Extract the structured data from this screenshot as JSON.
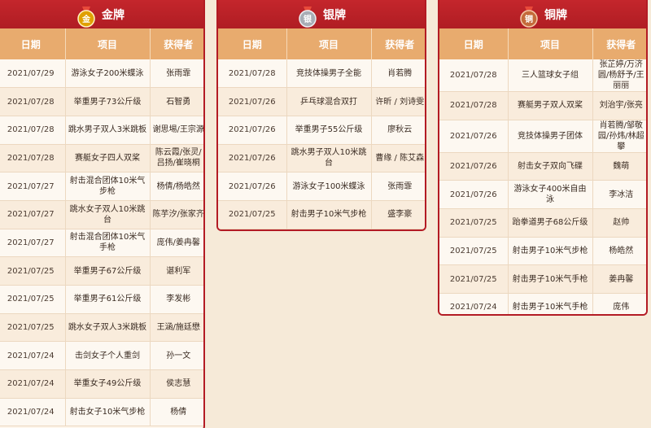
{
  "headers": {
    "date": "日期",
    "event": "项目",
    "winner": "获得者"
  },
  "gold": {
    "title": "金牌",
    "medal_char": "金",
    "medal_color": "#e0a000",
    "rows": [
      {
        "date": "2021/07/29",
        "event": "游泳女子200米蝶泳",
        "winner": "张雨霏"
      },
      {
        "date": "2021/07/28",
        "event": "举重男子73公斤级",
        "winner": "石智勇"
      },
      {
        "date": "2021/07/28",
        "event": "跳水男子双人3米跳板",
        "winner": "谢思埸/王宗源"
      },
      {
        "date": "2021/07/28",
        "event": "赛艇女子四人双桨",
        "winner": "陈云霞/张灵/吕扬/崔晓桐"
      },
      {
        "date": "2021/07/27",
        "event": "射击混合团体10米气步枪",
        "winner": "杨倩/杨皓然"
      },
      {
        "date": "2021/07/27",
        "event": "跳水女子双人10米跳台",
        "winner": "陈芋汐/张家齐"
      },
      {
        "date": "2021/07/27",
        "event": "射击混合团体10米气手枪",
        "winner": "庞伟/姜冉馨"
      },
      {
        "date": "2021/07/25",
        "event": "举重男子67公斤级",
        "winner": "谌利军"
      },
      {
        "date": "2021/07/25",
        "event": "举重男子61公斤级",
        "winner": "李发彬"
      },
      {
        "date": "2021/07/25",
        "event": "跳水女子双人3米跳板",
        "winner": "王涵/施廷懋"
      },
      {
        "date": "2021/07/24",
        "event": "击剑女子个人重剑",
        "winner": "孙一文"
      },
      {
        "date": "2021/07/24",
        "event": "举重女子49公斤级",
        "winner": "侯志慧"
      },
      {
        "date": "2021/07/24",
        "event": "射击女子10米气步枪",
        "winner": "杨倩"
      }
    ]
  },
  "silver": {
    "title": "银牌",
    "medal_char": "银",
    "medal_color": "#a8adb5",
    "rows": [
      {
        "date": "2021/07/28",
        "event": "竞技体操男子全能",
        "winner": "肖若腾"
      },
      {
        "date": "2021/07/26",
        "event": "乒乓球混合双打",
        "winner": "许昕 / 刘诗雯"
      },
      {
        "date": "2021/07/26",
        "event": "举重男子55公斤级",
        "winner": "廖秋云"
      },
      {
        "date": "2021/07/26",
        "event": "跳水男子双人10米跳台",
        "winner": "曹缘 / 陈艾森"
      },
      {
        "date": "2021/07/26",
        "event": "游泳女子100米蝶泳",
        "winner": "张雨霏"
      },
      {
        "date": "2021/07/25",
        "event": "射击男子10米气步枪",
        "winner": "盛李豪"
      }
    ]
  },
  "bronze": {
    "title": "铜牌",
    "medal_char": "铜",
    "medal_color": "#c46a3a",
    "rows": [
      {
        "date": "2021/07/28",
        "event": "三人篮球女子组",
        "winner": "张芷婷/万济圆/杨舒予/王丽丽"
      },
      {
        "date": "2021/07/28",
        "event": "赛艇男子双人双桨",
        "winner": "刘治宇/张亮"
      },
      {
        "date": "2021/07/26",
        "event": "竞技体操男子团体",
        "winner": "肖若腾/邹敬园/孙炜/林超攀"
      },
      {
        "date": "2021/07/26",
        "event": "射击女子双向飞碟",
        "winner": "魏萌"
      },
      {
        "date": "2021/07/26",
        "event": "游泳女子400米自由泳",
        "winner": "李冰洁"
      },
      {
        "date": "2021/07/25",
        "event": "跆拳道男子68公斤级",
        "winner": "赵帅"
      },
      {
        "date": "2021/07/25",
        "event": "射击男子10米气步枪",
        "winner": "杨皓然"
      },
      {
        "date": "2021/07/25",
        "event": "射击男子10米气手枪",
        "winner": "姜冉馨"
      },
      {
        "date": "2021/07/24",
        "event": "射击男子10米气手枪",
        "winner": "庞伟"
      }
    ]
  }
}
